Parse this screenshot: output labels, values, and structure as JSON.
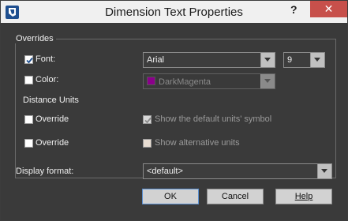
{
  "window": {
    "title": "Dimension Text Properties",
    "help_glyph": "?",
    "close_glyph": "✕"
  },
  "overrides": {
    "group_label": "Overrides",
    "font_label": "Font:",
    "font_value": "Arial",
    "size_value": "9",
    "color_label": "Color:",
    "color_value": "DarkMagenta",
    "color_swatch": "#8b008b"
  },
  "distance_units": {
    "label": "Distance Units",
    "override1_label": "Override",
    "show_default_label": "Show the default units' symbol",
    "override2_label": "Override",
    "show_alt_label": "Show alternative units"
  },
  "display_format": {
    "label": "Display format:",
    "value": "<default>"
  },
  "buttons": {
    "ok": "OK",
    "cancel": "Cancel",
    "help": "Help"
  }
}
